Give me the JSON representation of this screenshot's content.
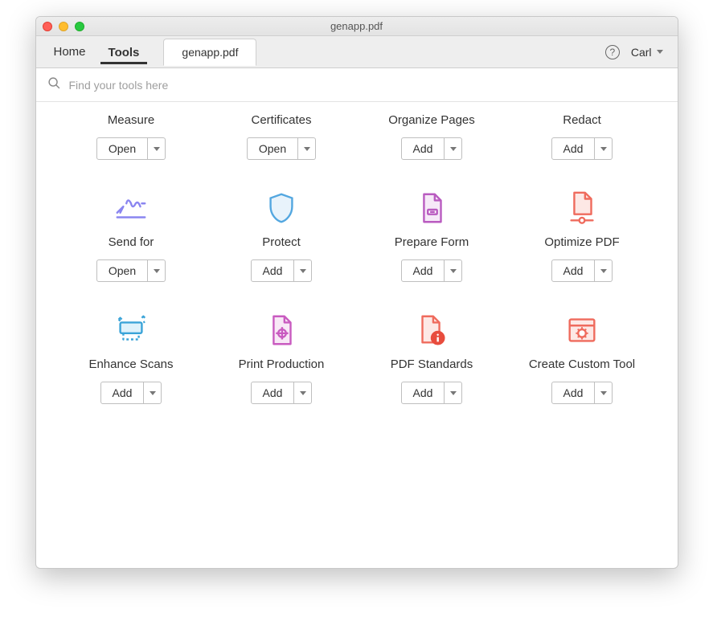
{
  "window": {
    "title": "genapp.pdf"
  },
  "toolbar": {
    "home": "Home",
    "tools": "Tools",
    "doc_tab": "genapp.pdf",
    "user": "Carl"
  },
  "search": {
    "placeholder": "Find your tools here"
  },
  "actions": {
    "open": "Open",
    "add": "Add"
  },
  "tools": {
    "r1": [
      {
        "label": "Measure",
        "action": "open"
      },
      {
        "label": "Certificates",
        "action": "open"
      },
      {
        "label": "Organize Pages",
        "action": "add"
      },
      {
        "label": "Redact",
        "action": "add"
      }
    ],
    "r2": [
      {
        "label": "Send for",
        "action": "open",
        "icon": "signature"
      },
      {
        "label": "Protect",
        "action": "add",
        "icon": "shield"
      },
      {
        "label": "Prepare Form",
        "action": "add",
        "icon": "form"
      },
      {
        "label": "Optimize PDF",
        "action": "add",
        "icon": "optimize"
      }
    ],
    "r3": [
      {
        "label": "Enhance Scans",
        "action": "add",
        "icon": "scanner"
      },
      {
        "label": "Print Production",
        "action": "add",
        "icon": "target-doc"
      },
      {
        "label": "PDF Standards",
        "action": "add",
        "icon": "info-doc"
      },
      {
        "label": "Create Custom Tool",
        "action": "add",
        "icon": "gear-window"
      }
    ]
  }
}
